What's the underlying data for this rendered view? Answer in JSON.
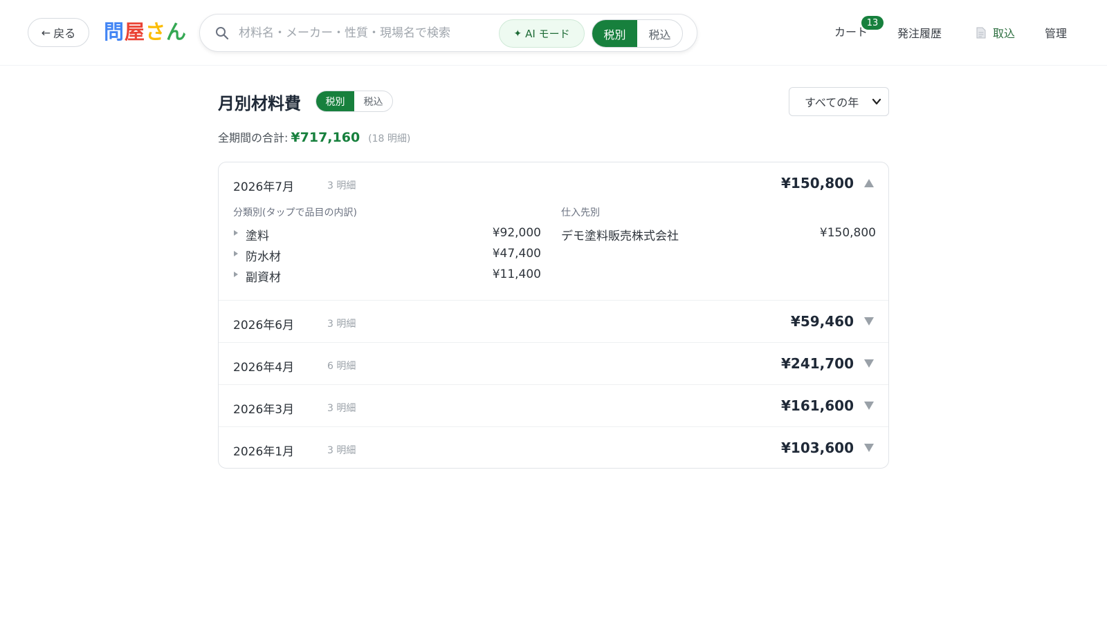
{
  "header": {
    "back_label": "戻る",
    "logo": [
      "問",
      "屋",
      "さ",
      "ん"
    ],
    "logo_colors": [
      "#4285f4",
      "#ea4335",
      "#fbbc05",
      "#34a853"
    ],
    "search_placeholder": "材料名・メーカー・性質・現場名で検索",
    "ai_mode_label": "AI モード",
    "tax_toggle": {
      "options": [
        "税別",
        "税込"
      ],
      "selected": "税別"
    },
    "nav": {
      "cart_label": "カート",
      "cart_count": "13",
      "history_label": "発注履歴",
      "import_label": "取込",
      "admin_label": "管理"
    }
  },
  "page": {
    "title": "月別材料費",
    "tax_toggle": {
      "options": [
        "税別",
        "税込"
      ],
      "selected": "税別"
    },
    "year_filter": "すべての年",
    "total_label": "全期間の合計:",
    "total_amount": "¥717,160",
    "total_count": "(18 明細)"
  },
  "months": [
    {
      "label": "2026年7月",
      "count": "3 明細",
      "total": "¥150,800",
      "expanded": true,
      "detail": {
        "category_heading": "分類別(タップで品目の内訳)",
        "supplier_heading": "仕入先別",
        "categories": [
          {
            "name": "塗料",
            "amount": "¥92,000"
          },
          {
            "name": "防水材",
            "amount": "¥47,400"
          },
          {
            "name": "副資材",
            "amount": "¥11,400"
          }
        ],
        "suppliers": [
          {
            "name": "デモ塗料販売株式会社",
            "amount": "¥150,800"
          }
        ]
      }
    },
    {
      "label": "2026年6月",
      "count": "3 明細",
      "total": "¥59,460",
      "expanded": false
    },
    {
      "label": "2026年4月",
      "count": "6 明細",
      "total": "¥241,700",
      "expanded": false
    },
    {
      "label": "2026年3月",
      "count": "3 明細",
      "total": "¥161,600",
      "expanded": false
    },
    {
      "label": "2026年1月",
      "count": "3 明細",
      "total": "¥103,600",
      "expanded": false
    }
  ],
  "colors": {
    "accent": "#17803d",
    "toggle_icon": "#9aa1a8"
  }
}
